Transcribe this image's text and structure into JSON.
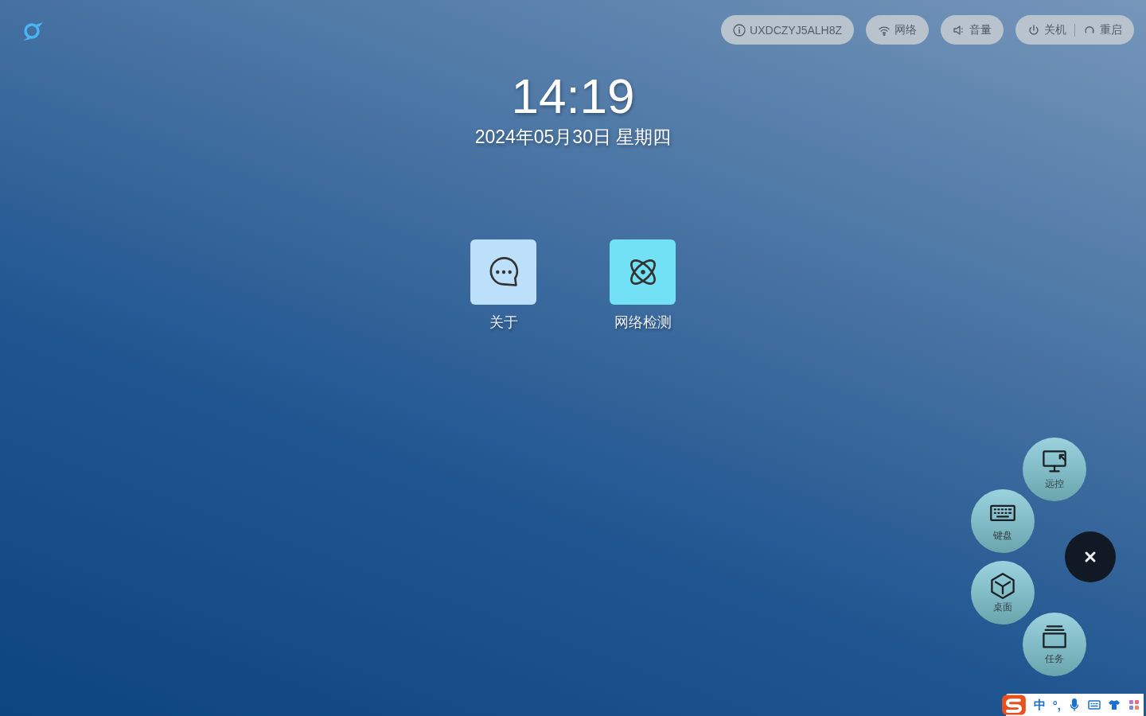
{
  "top_bar": {
    "device_id": "UXDCZYJ5ALH8Z",
    "network": "网络",
    "volume": "音量",
    "shutdown": "关机",
    "restart": "重启"
  },
  "clock": {
    "time": "14:19",
    "date": "2024年05月30日 星期四"
  },
  "apps": [
    {
      "label": "关于",
      "kind": "about"
    },
    {
      "label": "网络检测",
      "kind": "network"
    }
  ],
  "float_menu": {
    "expanded": true,
    "items": [
      {
        "label": "远控",
        "kind": "remote"
      },
      {
        "label": "键盘",
        "kind": "keyboard"
      },
      {
        "label": "桌面",
        "kind": "desktop"
      },
      {
        "label": "任务",
        "kind": "tasks"
      }
    ]
  },
  "ime_bar": {
    "mode": "中",
    "punctuation": "°,"
  }
}
